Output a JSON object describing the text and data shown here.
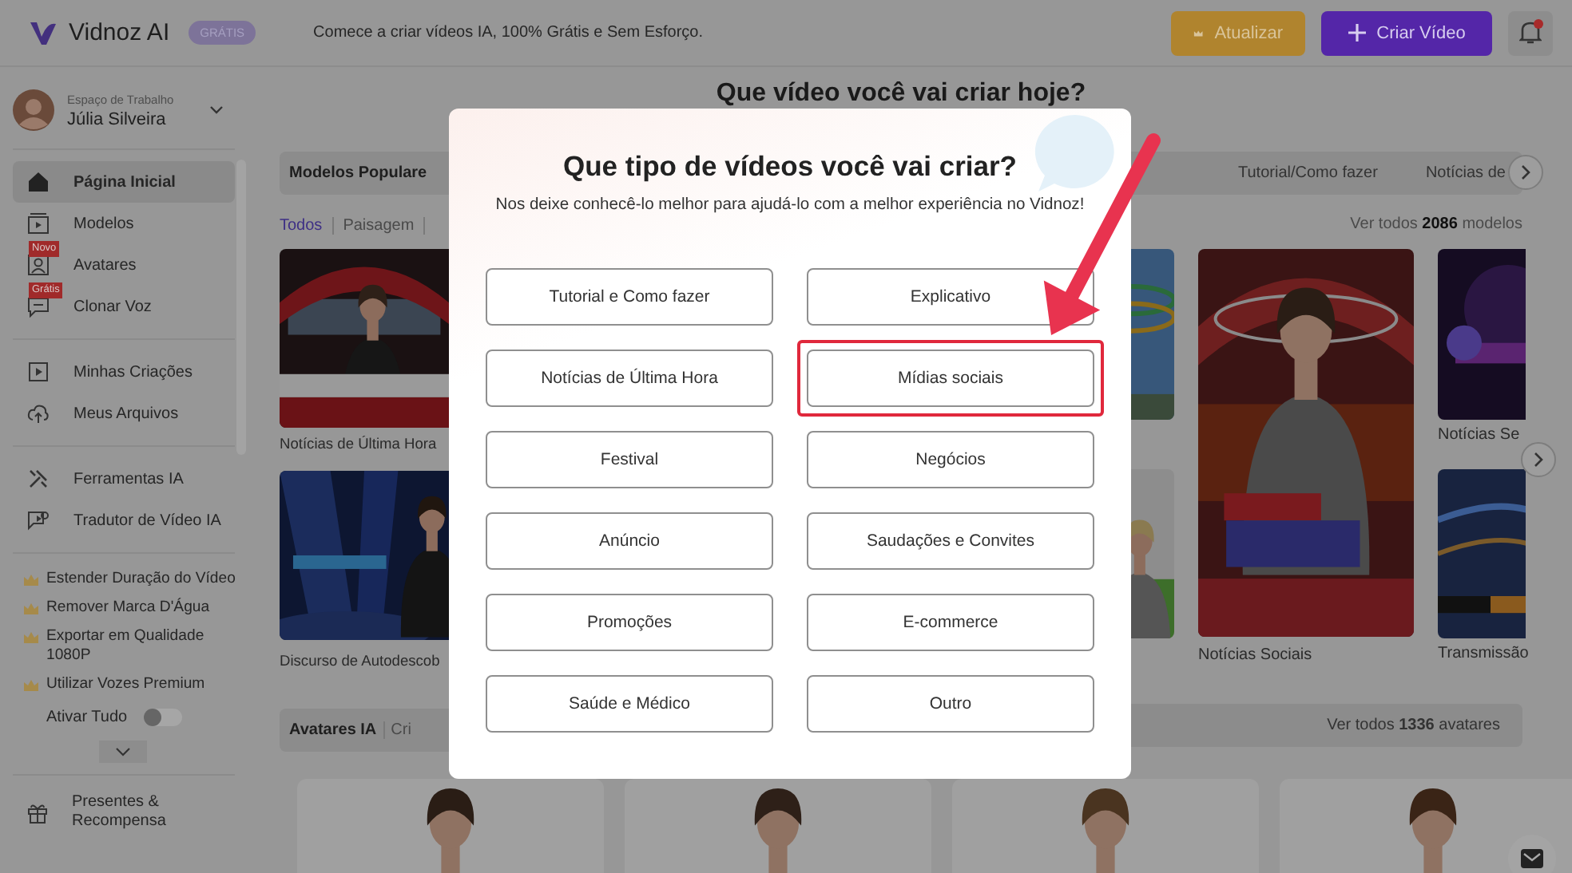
{
  "header": {
    "logo": "Vidnoz AI",
    "plan_badge": "GRÁTIS",
    "tagline": "Comece a criar vídeos IA, 100% Grátis e Sem Esforço.",
    "buttons": [
      {
        "kind": "upgrade",
        "label": "Atualizar"
      },
      {
        "kind": "create",
        "label": "Criar Vídeo"
      }
    ],
    "notification_dot": true
  },
  "sidebar": {
    "workspace_label": "Espaço de Trabalho",
    "user": "Júlia Silveira",
    "groups": [
      [
        {
          "label": "Página Inicial",
          "selected": true
        },
        {
          "label": "Modelos",
          "selected": false
        },
        {
          "label": "Avatares",
          "selected": false,
          "badge": "Novo"
        },
        {
          "label": "Clonar Voz",
          "selected": false,
          "badge": "Grátis"
        }
      ],
      [
        {
          "label": "Minhas Criações",
          "selected": false
        },
        {
          "label": "Meus Arquivos",
          "selected": false
        }
      ],
      [
        {
          "label": "Ferramentas IA",
          "selected": false
        },
        {
          "label": "Tradutor de Vídeo IA",
          "selected": false
        }
      ]
    ],
    "premium": [
      "Estender Duração do Vídeo",
      "Remover Marca D'Água",
      "Exportar em Qualidade 1080P",
      "Utilizar Vozes Premium"
    ],
    "toggle": {
      "label": "Ativar Tudo",
      "on": false
    },
    "footer": "Presentes & Recompensa"
  },
  "main": {
    "heading": "Que vídeo você vai criar hoje?",
    "templates": {
      "title": "Modelos Populare",
      "tabs": [
        {
          "label": "Todos",
          "selected": true
        },
        {
          "label": "Paisagem",
          "selected": false
        }
      ],
      "categories": [
        "Tutorial/Como fazer",
        "Notícias de"
      ],
      "view_all": "Ver todos **2086** modelos",
      "left_cards": [
        {
          "caption": "Notícias de Última Hora"
        },
        {
          "caption": "Discurso de Autodescob"
        }
      ],
      "right_cards": [
        {
          "caption": "Notícias Sociais"
        },
        {
          "caption": "Notícias Se"
        },
        {
          "caption": "Transmissão"
        }
      ]
    },
    "avatars": {
      "title": "Avatares IA",
      "tab": "Cri",
      "view_all": "Ver todos **1336** avatares"
    }
  },
  "modal": {
    "title": "Que tipo de vídeos você vai criar?",
    "subtitle": "Nos deixe conhecê-lo melhor para ajudá-lo com a melhor experiência no Vidnoz!",
    "options": [
      {
        "label": "Tutorial e Como fazer",
        "highlighted": false
      },
      {
        "label": "Explicativo",
        "highlighted": false
      },
      {
        "label": "Notícias de Última Hora",
        "highlighted": false
      },
      {
        "label": "Mídias sociais",
        "highlighted": true
      },
      {
        "label": "Festival",
        "highlighted": false
      },
      {
        "label": "Negócios",
        "highlighted": false
      },
      {
        "label": "Anúncio",
        "highlighted": false
      },
      {
        "label": "Saudações e Convites",
        "highlighted": false
      },
      {
        "label": "Promoções",
        "highlighted": false
      },
      {
        "label": "E-commerce",
        "highlighted": false
      },
      {
        "label": "Saúde e Médico",
        "highlighted": false
      },
      {
        "label": "Outro",
        "highlighted": false
      }
    ]
  }
}
